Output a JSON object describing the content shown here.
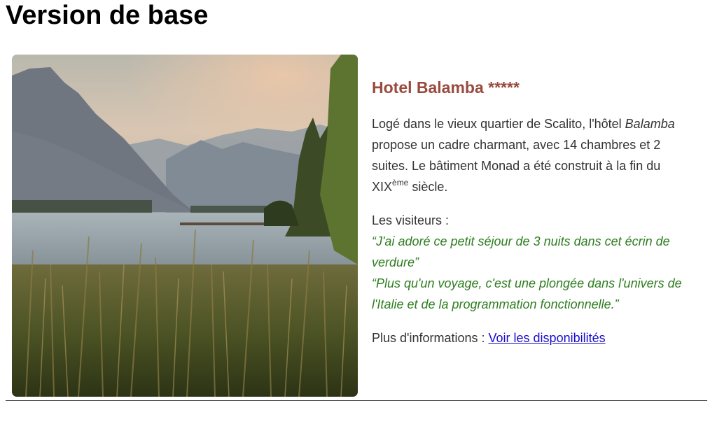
{
  "page": {
    "title": "Version de base"
  },
  "hotel": {
    "name": "Hotel Balamba *****",
    "photo_icon": "lake-landscape-photo",
    "description": {
      "part1": "Logé dans le vieux quartier de Scalito, l'hôtel ",
      "name_italic": "Balamba",
      "part2": " propose un cadre charmant, avec 14 chambres et 2 suites. Le bâtiment Monad a été construit à la fin du XIX",
      "superscript": "ème",
      "part3": " siècle."
    },
    "visitors_label": "Les visiteurs :",
    "quotes": [
      "“J'ai adoré ce petit séjour de 3 nuits dans cet écrin de verdure”",
      "“Plus qu'un voyage, c'est une plongée dans l'univers de l'Italie et de la programmation fonctionnelle.”"
    ],
    "more_label": "Plus d'informations : ",
    "availability_link": "Voir les disponibilités"
  },
  "colors": {
    "hotel_name": "#9a4a3e",
    "quote": "#2e7d1f",
    "link": "#1a0dcc"
  }
}
